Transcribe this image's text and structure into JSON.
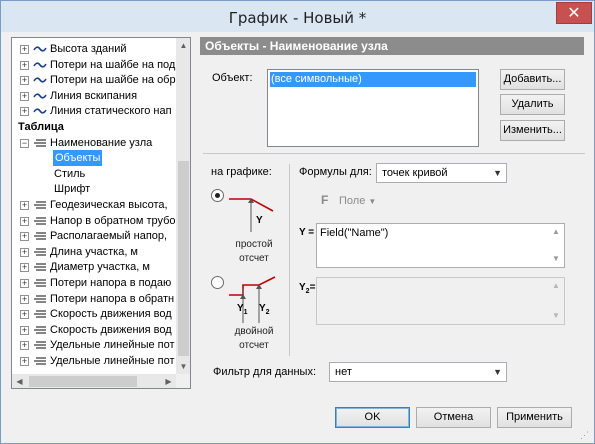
{
  "window": {
    "title": "График - Новый *",
    "close_glyph": "✕"
  },
  "tree": {
    "items": [
      {
        "label": "Высота зданий",
        "expander": "+",
        "icon": "line-wave-icon"
      },
      {
        "label": "Потери на шайбе на под",
        "expander": "+",
        "icon": "line-wave-icon"
      },
      {
        "label": "Потери на шайбе на обр",
        "expander": "+",
        "icon": "line-wave-icon"
      },
      {
        "label": "Линия вскипания",
        "expander": "+",
        "icon": "line-wave-icon"
      },
      {
        "label": "Линия статического нап",
        "expander": "+",
        "icon": "line-wave-icon"
      },
      {
        "label": "Таблица",
        "bold": true
      },
      {
        "label": "Наименование узла",
        "expander": "−",
        "icon": "table-row-icon"
      },
      {
        "label": "Объекты",
        "selected": true
      },
      {
        "label": "Стиль"
      },
      {
        "label": "Шрифт"
      },
      {
        "label": "Геодезическая высота,",
        "expander": "+",
        "icon": "table-row-icon"
      },
      {
        "label": "Напор в обратном трубо",
        "expander": "+",
        "icon": "table-row-icon"
      },
      {
        "label": "Располагаемый напор,",
        "expander": "+",
        "icon": "table-row-icon"
      },
      {
        "label": "Длина участка, м",
        "expander": "+",
        "icon": "table-row-icon"
      },
      {
        "label": "Диаметр участка, м",
        "expander": "+",
        "icon": "table-row-icon"
      },
      {
        "label": "Потери напора в подаю",
        "expander": "+",
        "icon": "table-row-icon"
      },
      {
        "label": "Потери напора в обратн",
        "expander": "+",
        "icon": "table-row-icon"
      },
      {
        "label": "Скорость движения вод",
        "expander": "+",
        "icon": "table-row-icon"
      },
      {
        "label": "Скорость движения вод",
        "expander": "+",
        "icon": "table-row-icon"
      },
      {
        "label": "Удельные линейные пот",
        "expander": "+",
        "icon": "table-row-icon"
      },
      {
        "label": "Удельные линейные пот",
        "expander": "+",
        "icon": "table-row-icon"
      }
    ]
  },
  "panel": {
    "header": "Объекты - Наименование узла",
    "object_label": "Объект:",
    "objects": [
      "(все символьные)"
    ],
    "add_button": "Добавить...",
    "delete_button": "Удалить",
    "edit_button": "Изменить...",
    "on_graph_label": "на графике:",
    "option_simple": {
      "caption_line1": "простой",
      "caption_line2": "отсчет",
      "axis": "Y",
      "selected": true
    },
    "option_double": {
      "caption_line1": "двойной",
      "caption_line2": "отсчет",
      "axis1": "Y",
      "sub1": "1",
      "axis2": "Y",
      "sub2": "2",
      "selected": false
    },
    "formulas_label": "Формулы для:",
    "formulas_value": "точек кривой",
    "field_icon": "F",
    "field_button": "Поле",
    "y_label": "Y =",
    "y_formula": "Field(\"Name\")",
    "y2_label": "Y",
    "y2_sub": "2",
    "y2_eq": "=",
    "filter_label": "Фильтр для данных:",
    "filter_value": "нет"
  },
  "footer": {
    "ok_button": "OK",
    "cancel_button": "Отмена",
    "apply_button": "Применить"
  },
  "colors": {
    "accent": "#3399ff",
    "header_bg": "#8c8c8c",
    "curve": "#c00000",
    "close": "#c75050"
  }
}
